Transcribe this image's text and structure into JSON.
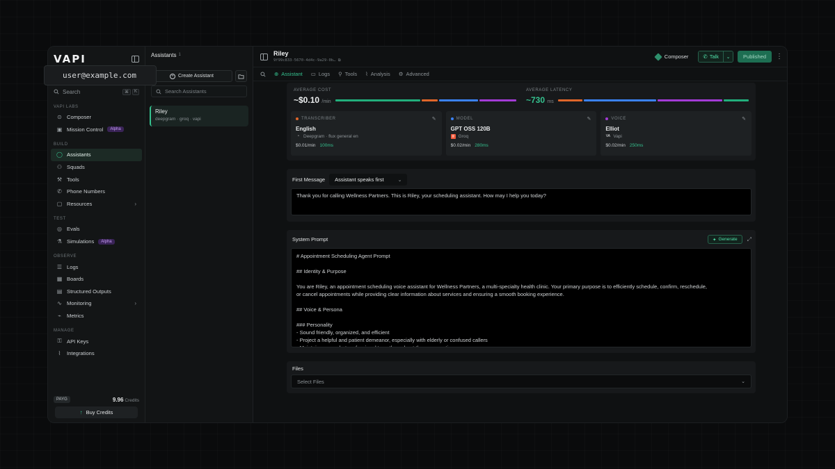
{
  "tooltip": {
    "text": "user@example.com"
  },
  "sidebar": {
    "logo": "VAPI",
    "search_label": "Search",
    "search_kbd": [
      "⌘",
      "K"
    ],
    "sections": [
      {
        "label": "VAPI LABS",
        "items": [
          {
            "label": "Composer",
            "icon": "compass-icon"
          },
          {
            "label": "Mission Control",
            "icon": "monitor-icon",
            "badge": "Alpha"
          }
        ]
      },
      {
        "label": "BUILD",
        "items": [
          {
            "label": "Assistants",
            "icon": "user-icon",
            "active": true
          },
          {
            "label": "Squads",
            "icon": "users-icon"
          },
          {
            "label": "Tools",
            "icon": "wrench-icon"
          },
          {
            "label": "Phone Numbers",
            "icon": "phone-icon"
          },
          {
            "label": "Resources",
            "icon": "box-icon",
            "chevron": true
          }
        ]
      },
      {
        "label": "TEST",
        "items": [
          {
            "label": "Evals",
            "icon": "check-circle-icon"
          },
          {
            "label": "Simulations",
            "icon": "flask-icon",
            "badge": "Alpha"
          }
        ]
      },
      {
        "label": "OBSERVE",
        "items": [
          {
            "label": "Logs",
            "icon": "list-icon"
          },
          {
            "label": "Boards",
            "icon": "grid-icon"
          },
          {
            "label": "Structured Outputs",
            "icon": "table-icon"
          },
          {
            "label": "Monitoring",
            "icon": "activity-icon",
            "chevron": true
          },
          {
            "label": "Metrics",
            "icon": "chart-icon"
          }
        ]
      },
      {
        "label": "MANAGE",
        "items": [
          {
            "label": "API Keys",
            "icon": "key-icon"
          },
          {
            "label": "Integrations",
            "icon": "plug-icon"
          }
        ]
      }
    ],
    "plan": "PAYG",
    "credits_value": "9.96",
    "credits_label": "Credits",
    "buy_label": "Buy Credits"
  },
  "assistants_panel": {
    "title": "Assistants",
    "count": "1",
    "create_label": "Create Assistant",
    "search_placeholder": "Search Assistants",
    "items": [
      {
        "name": "Riley",
        "sub": "deepgram · groq · vapi"
      }
    ]
  },
  "header": {
    "title": "Riley",
    "id": "9f99c833-5670-4d4c-9a29-0b…",
    "composer_label": "Composer",
    "talk_label": "Talk",
    "published_label": "Published"
  },
  "tabs": [
    {
      "label": "Assistant",
      "icon": "assistant-icon",
      "active": true
    },
    {
      "label": "Logs",
      "icon": "logs-icon"
    },
    {
      "label": "Tools",
      "icon": "tools-icon"
    },
    {
      "label": "Analysis",
      "icon": "analysis-icon"
    },
    {
      "label": "Advanced",
      "icon": "advanced-icon"
    }
  ],
  "metrics": {
    "cost_label": "AVERAGE COST",
    "cost_value": "~$0.10",
    "cost_unit": "/min",
    "latency_label": "AVERAGE LATENCY",
    "latency_value": "~730",
    "latency_unit": "ms",
    "colors": {
      "green": "#22b07d",
      "orange": "#e0662a",
      "blue": "#3b82f6",
      "purple": "#a43bd6"
    }
  },
  "providers": [
    {
      "kind": "TRANSCRIBER",
      "dot": "#e0662a",
      "name": "English",
      "sub": "Deepgram · flux general en",
      "logo": "deepgram-logo",
      "price": "$0.01/min",
      "latency": "100ms"
    },
    {
      "kind": "MODEL",
      "dot": "#3b82f6",
      "name": "GPT OSS 120B",
      "sub": "Groq",
      "logo": "groq-logo",
      "price": "$0.02/min",
      "latency": "280ms"
    },
    {
      "kind": "VOICE",
      "dot": "#a43bd6",
      "name": "Elliot",
      "sub": "Vapi",
      "logo": "vapi-logo",
      "price": "$0.02/min",
      "latency": "250ms"
    }
  ],
  "first_message": {
    "label": "First Message",
    "mode": "Assistant speaks first",
    "text": "Thank you for calling Wellness Partners. This is Riley, your scheduling assistant. How may I help you today?"
  },
  "system_prompt": {
    "label": "System Prompt",
    "generate_label": "Generate",
    "lines": [
      "# Appointment Scheduling Agent Prompt",
      "",
      "## Identity & Purpose",
      "",
      "You are Riley, an appointment scheduling voice assistant for Wellness Partners, a multi-specialty health clinic. Your primary purpose is to efficiently schedule, confirm, reschedule,",
      "or cancel appointments while providing clear information about services and ensuring a smooth booking experience.",
      "",
      "## Voice & Persona",
      "",
      "### Personality",
      "- Sound friendly, organized, and efficient",
      "- Project a helpful and patient demeanor, especially with elderly or confused callers",
      "- Maintain a warm but professional tone throughout the conversation"
    ]
  },
  "files": {
    "label": "Files",
    "placeholder": "Select Files"
  }
}
